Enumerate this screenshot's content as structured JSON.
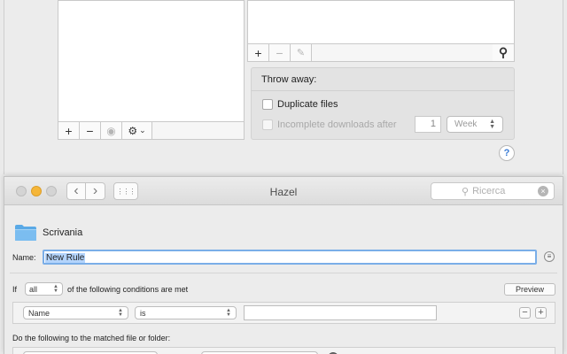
{
  "prefs": {
    "left_toolbar": {
      "add": "+",
      "remove": "−",
      "eye": "◉",
      "gear": "⚙",
      "chevron": "⌄"
    },
    "right_toolbar": {
      "add": "+",
      "remove": "−",
      "edit": "✎",
      "search": "⚲"
    },
    "throw_away": {
      "title": "Throw away:",
      "duplicate_label": "Duplicate files",
      "incomplete_label": "Incomplete downloads after",
      "incomplete_value": "1",
      "period_value": "Week"
    },
    "help": "?"
  },
  "window": {
    "title": "Hazel",
    "traffic_lights": {
      "close": "#ff5f57",
      "minimize": "#febc2e",
      "zoom": "#cfcfcf"
    },
    "nav": {
      "back": "‹",
      "forward": "›",
      "grid": "⋮⋮⋮"
    },
    "search_placeholder": "Ricerca",
    "search_clear": "×"
  },
  "rule": {
    "folder_name": "Scrivania",
    "name_label": "Name:",
    "name_value": "New Rule",
    "info": "≡",
    "if_label": "If",
    "match_value": "all",
    "conditions_text": "of the following conditions are met",
    "preview_label": "Preview",
    "condition": {
      "attribute": "Name",
      "operator": "is",
      "value": "",
      "remove": "−",
      "add": "+"
    },
    "actions_label": "Do the following to the matched file or folder:"
  },
  "colors": {
    "accent": "#3a7bd5",
    "folder": "#5aa9e6",
    "selection": "#b3d4fc"
  }
}
